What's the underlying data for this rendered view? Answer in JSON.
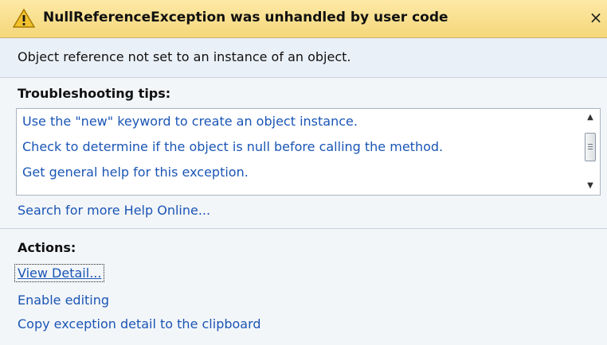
{
  "dialog": {
    "title": "NullReferenceException was unhandled by user code",
    "title_icon": "warning-icon",
    "close_glyph": "×",
    "message": "Object reference not set to an instance of an object."
  },
  "troubleshooting": {
    "heading": "Troubleshooting tips:",
    "tips": [
      "Use the \"new\" keyword to create an object instance.",
      "Check to determine if the object is null before calling the method.",
      "Get general help for this exception."
    ],
    "search_link": "Search for more Help Online..."
  },
  "actions": {
    "heading": "Actions:",
    "items": [
      "View Detail...",
      "Enable editing",
      "Copy exception detail to the clipboard"
    ]
  },
  "colors": {
    "titlebar": "#f5d77a",
    "message_background": "#eaf0f7",
    "section_background": "#f3f6f9",
    "link": "#1a55b5"
  }
}
